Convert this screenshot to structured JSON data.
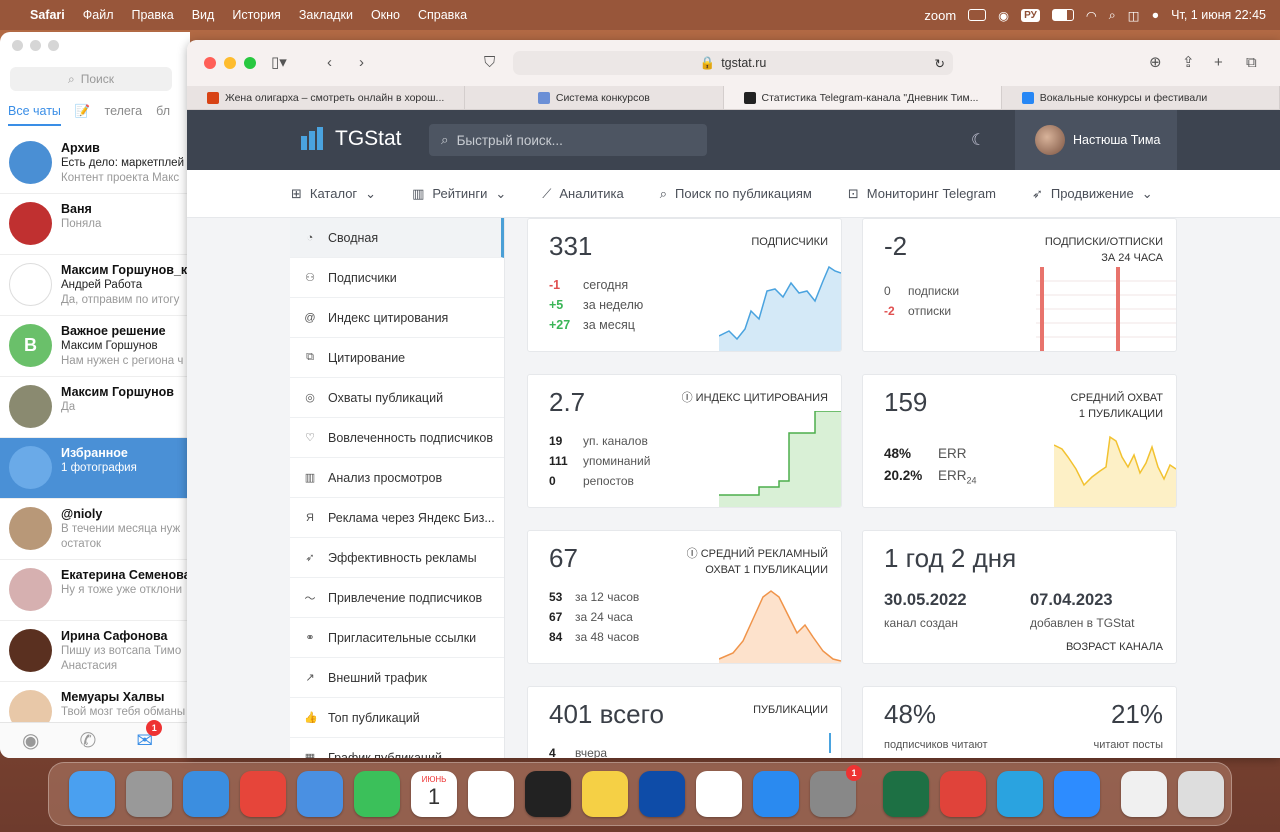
{
  "menubar": {
    "app": "Safari",
    "items": [
      "Файл",
      "Правка",
      "Вид",
      "История",
      "Закладки",
      "Окно",
      "Справка"
    ],
    "zoom": "zoom",
    "lang": "РУ",
    "datetime": "Чт, 1 июня  22:45"
  },
  "telegram": {
    "search_placeholder": "Поиск",
    "tabs": [
      "Все чаты",
      "телега",
      "бл"
    ],
    "chats": [
      {
        "name": "Архив",
        "line2": "Есть дело: маркетплей",
        "line3": "Контент проекта Макс",
        "avatar": "#4a8fd4"
      },
      {
        "name": "Ваня",
        "line2": "",
        "line3": "Поняла",
        "avatar": "#c03030"
      },
      {
        "name": "Максим Горшунов_кт",
        "line2": "Андрей Работа",
        "line3": "Да, отправим по итогу",
        "avatar": "#ffffff"
      },
      {
        "name": "Важное решение",
        "line2": "Максим Горшунов",
        "line3": "Нам нужен с региона ч",
        "avatar": "#6ac06a",
        "initial": "В"
      },
      {
        "name": "Максим Горшунов",
        "line2": "",
        "line3": "Да",
        "avatar": "#8a8a70"
      },
      {
        "name": "Избранное",
        "line2": "1 фотография",
        "line3": "",
        "avatar": "#6aaae8",
        "selected": true
      },
      {
        "name": "@nioly",
        "line2": "",
        "line3": "В течении месяца нуж",
        "line4": "остаток",
        "avatar": "#b89878"
      },
      {
        "name": "Екатерина Семенова",
        "line2": "",
        "line3": "Ну я тоже уже отклони",
        "avatar": "#d6b0b0"
      },
      {
        "name": "Ирина Сафонова",
        "line2": "",
        "line3": "Пишу из вотсапа  Тимо",
        "line4": "Анастасия",
        "avatar": "#5a3020"
      },
      {
        "name": "Мемуары Халвы",
        "line2": "",
        "line3": "Твой мозг тебя обманы",
        "avatar": "#e8c8a8"
      }
    ],
    "chat_badge": "1"
  },
  "safari": {
    "url": "tgstat.ru",
    "tabs": [
      {
        "title": "Жена олигарха – смотреть онлайн в хорош...",
        "color": "#d84315"
      },
      {
        "title": "Система конкурсов",
        "color": "#6b8fd6",
        "label": "FCS"
      },
      {
        "title": "Статистика Telegram-канала \"Дневник Тим...",
        "color": "#222"
      },
      {
        "title": "Вокальные конкурсы и фестивали",
        "color": "#2787f5",
        "label": "VK"
      }
    ]
  },
  "tgstat": {
    "logo": "TGStat",
    "search_placeholder": "Быстрый поиск...",
    "user": "Настюша Тима",
    "nav": [
      "Каталог",
      "Рейтинги",
      "Аналитика",
      "Поиск по публикациям",
      "Мониторинг Telegram",
      "Продвижение"
    ],
    "side": [
      "Сводная",
      "Подписчики",
      "Индекс цитирования",
      "Цитирование",
      "Охваты публикаций",
      "Вовлеченность подписчиков",
      "Анализ просмотров",
      "Реклама через Яндекс Биз...",
      "Эффективность рекламы",
      "Привлечение подписчиков",
      "Пригласительные ссылки",
      "Внешний трафик",
      "Топ публикаций",
      "График публикаций"
    ],
    "subs": {
      "value": "331",
      "caption": "ПОДПИСЧИКИ",
      "rows": [
        {
          "v": "-1",
          "t": "сегодня"
        },
        {
          "v": "+5",
          "t": "за неделю"
        },
        {
          "v": "+27",
          "t": "за месяц"
        }
      ]
    },
    "subunsub": {
      "value": "-2",
      "caption1": "ПОДПИСКИ/ОТПИСКИ",
      "caption2": "ЗА 24 ЧАСА",
      "rows": [
        {
          "v": "0",
          "t": "подписки"
        },
        {
          "v": "-2",
          "t": "отписки"
        }
      ]
    },
    "citation": {
      "value": "2.7",
      "caption": "ИНДЕКС ЦИТИРОВАНИЯ",
      "rows": [
        {
          "v": "19",
          "t": "уп. каналов"
        },
        {
          "v": "111",
          "t": "упоминаний"
        },
        {
          "v": "0",
          "t": "репостов"
        }
      ]
    },
    "reach": {
      "value": "159",
      "caption1": "СРЕДНИЙ ОХВАТ",
      "caption2": "1 ПУБЛИКАЦИИ",
      "err": "48%",
      "err_label": "ERR",
      "err24": "20.2%",
      "err24_label": "ERR",
      "err24_sub": "24"
    },
    "adreach": {
      "value": "67",
      "caption1": "СРЕДНИЙ РЕКЛАМНЫЙ",
      "caption2": "ОХВАТ 1 ПУБЛИКАЦИИ",
      "rows": [
        {
          "v": "53",
          "t": "за 12 часов"
        },
        {
          "v": "67",
          "t": "за 24 часа"
        },
        {
          "v": "84",
          "t": "за 48 часов"
        }
      ]
    },
    "age": {
      "value": "1 год 2 дня",
      "created": "30.05.2022",
      "created_label": "канал создан",
      "added": "07.04.2023",
      "added_label": "добавлен в TGStat",
      "caption": "ВОЗРАСТ КАНАЛА"
    },
    "posts": {
      "value": "401 всего",
      "caption": "ПУБЛИКАЦИИ",
      "row_v": "4",
      "row_t": "вчера"
    },
    "readers": {
      "left": "48%",
      "left_label": "подписчиков читают",
      "right": "21%",
      "right_label": "читают посты"
    }
  },
  "dock_badge_settings": "1",
  "dock_calendar_month": "ИЮНЬ",
  "dock_calendar_day": "1"
}
